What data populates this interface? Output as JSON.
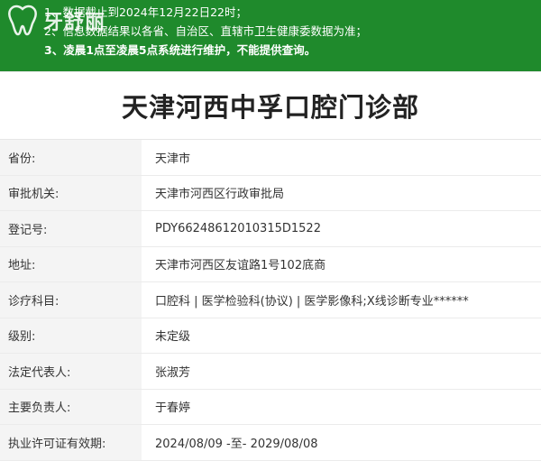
{
  "notice": {
    "lines": [
      "1、数据截止到2024年12月22日22时；",
      "2、信息数据结果以各省、自治区、直辖市卫生健康委数据为准；",
      "3、凌晨1点至凌晨5点系统进行维护，不能提供查询。"
    ],
    "bg_color": "#1f8a2c"
  },
  "watermark": {
    "text": "牙舒丽",
    "icon": "tooth-icon"
  },
  "title": "天津河西中孚口腔门诊部",
  "rows": [
    {
      "label": "省份:",
      "value": "天津市"
    },
    {
      "label": "审批机关:",
      "value": "天津市河西区行政审批局"
    },
    {
      "label": "登记号:",
      "value": "PDY66248612010315D1522"
    },
    {
      "label": "地址:",
      "value": "天津市河西区友谊路1号102底商"
    },
    {
      "label": "诊疗科目:",
      "value": "口腔科 | 医学检验科(协议) | 医学影像科;X线诊断专业******"
    },
    {
      "label": "级别:",
      "value": "未定级"
    },
    {
      "label": "法定代表人:",
      "value": "张淑芳"
    },
    {
      "label": "主要负责人:",
      "value": "于春婷"
    },
    {
      "label": "执业许可证有效期:",
      "value": "2024/08/09 -至- 2029/08/08"
    }
  ]
}
